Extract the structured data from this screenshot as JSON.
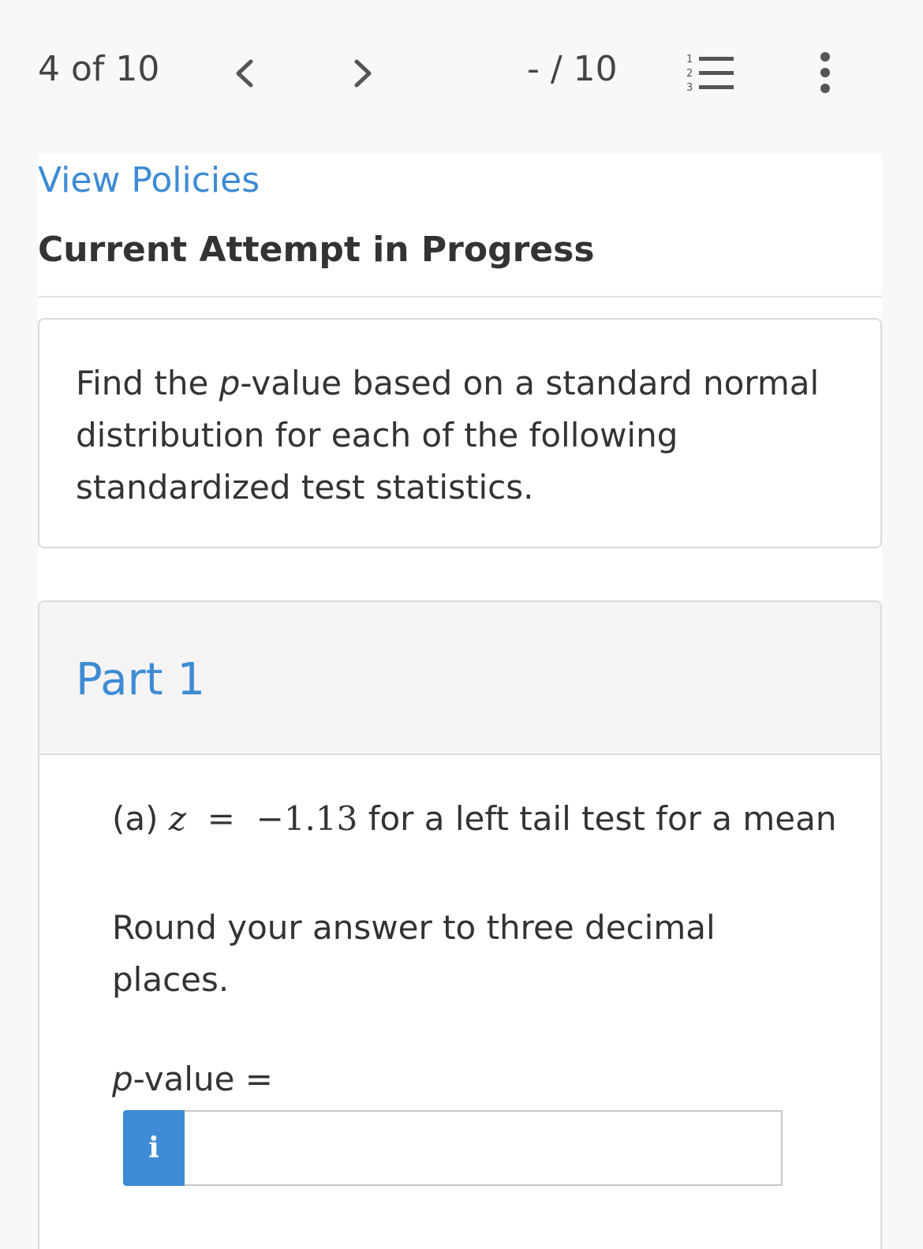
{
  "topbar": {
    "counter": "4 of 10",
    "score": "- / 10",
    "prev_icon": "chevron-left-icon",
    "next_icon": "chevron-right-icon",
    "list_icon": "numbered-list-icon",
    "more_icon": "more-vertical-icon"
  },
  "content": {
    "view_policies": "View Policies",
    "attempt_heading": "Current Attempt in Progress",
    "question_text": "Find the p-value based on a standard normal distribution for each of the following standardized test statistics."
  },
  "part": {
    "title": "Part 1",
    "label": "(a)",
    "z_var": "z",
    "equals": "=",
    "z_value": "−1.13",
    "prompt_suffix": "for a left tail test for a mean",
    "round_text": "Round your answer to three decimal places.",
    "pvalue_label": "p-value =",
    "info_icon_label": "i",
    "answer_value": ""
  },
  "colors": {
    "accent": "#3d8bd4",
    "background": "#f8f8f8",
    "text": "#333333"
  }
}
